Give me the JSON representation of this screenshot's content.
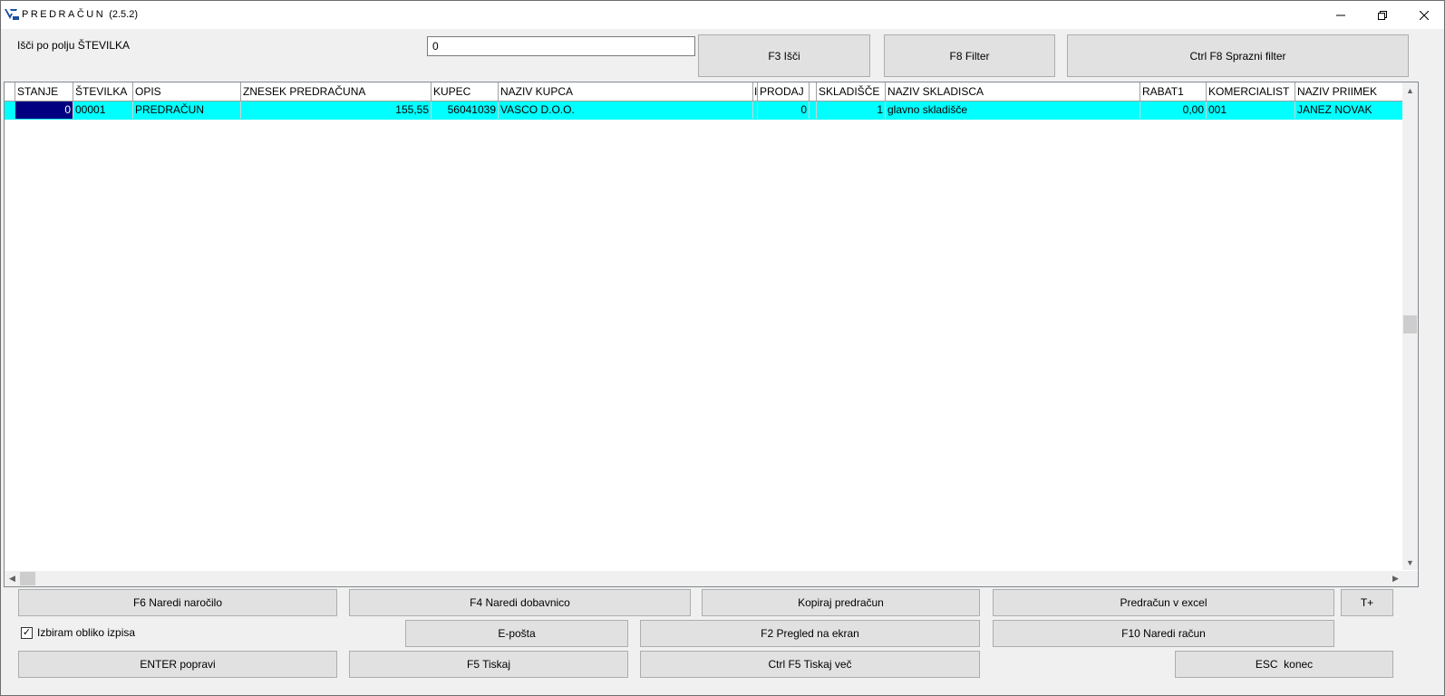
{
  "window": {
    "title": "PREDRAČUN",
    "version": "(2.5.2)",
    "minimize_icon": "minimize-icon",
    "restore_icon": "restore-icon",
    "close_icon": "close-icon"
  },
  "search": {
    "label": "Išči po polju ŠTEVILKA",
    "value": "0"
  },
  "top_buttons": {
    "search": "F3 Išči",
    "filter": "F8 Filter",
    "clear_filter": "Ctrl F8 Sprazni filter"
  },
  "table": {
    "columns": [
      "STANJE",
      "ŠTEVILKA",
      "OPIS",
      "ZNESEK PREDRAČUNA",
      "KUPEC",
      "NAZIV KUPCA",
      "I",
      "PRODAJ",
      "",
      "SKLADIŠČE",
      "NAZIV SKLADISCA",
      "RABAT1",
      "KOMERCIALIST",
      "NAZIV PRIIMEK"
    ],
    "rows": [
      [
        "0",
        "00001",
        "PREDRAČUN",
        "155,55",
        "56041039",
        "VASCO D.O.O.",
        "",
        "0",
        "",
        "1",
        "glavno skladišče",
        "0,00",
        "001",
        "JANEZ NOVAK"
      ]
    ]
  },
  "bottom_buttons": {
    "order": "F6 Naredi naročilo",
    "delivery": "F4 Naredi dobavnico",
    "copy": "Kopiraj predračun",
    "excel": "Predračun v excel",
    "tplus": "T+",
    "email": "E-pošta",
    "preview": "F2 Pregled na ekran",
    "invoice": "F10 Naredi račun",
    "edit": "ENTER popravi",
    "print": "F5 Tiskaj",
    "print_more": "Ctrl F5 Tiskaj več",
    "exit": "ESC  konec"
  },
  "options": {
    "choose_format_label": "Izbiram obliko izpisa",
    "choose_format_checked": true
  },
  "colors": {
    "selected_row": "#00ffff",
    "selected_cell": "#000080"
  }
}
